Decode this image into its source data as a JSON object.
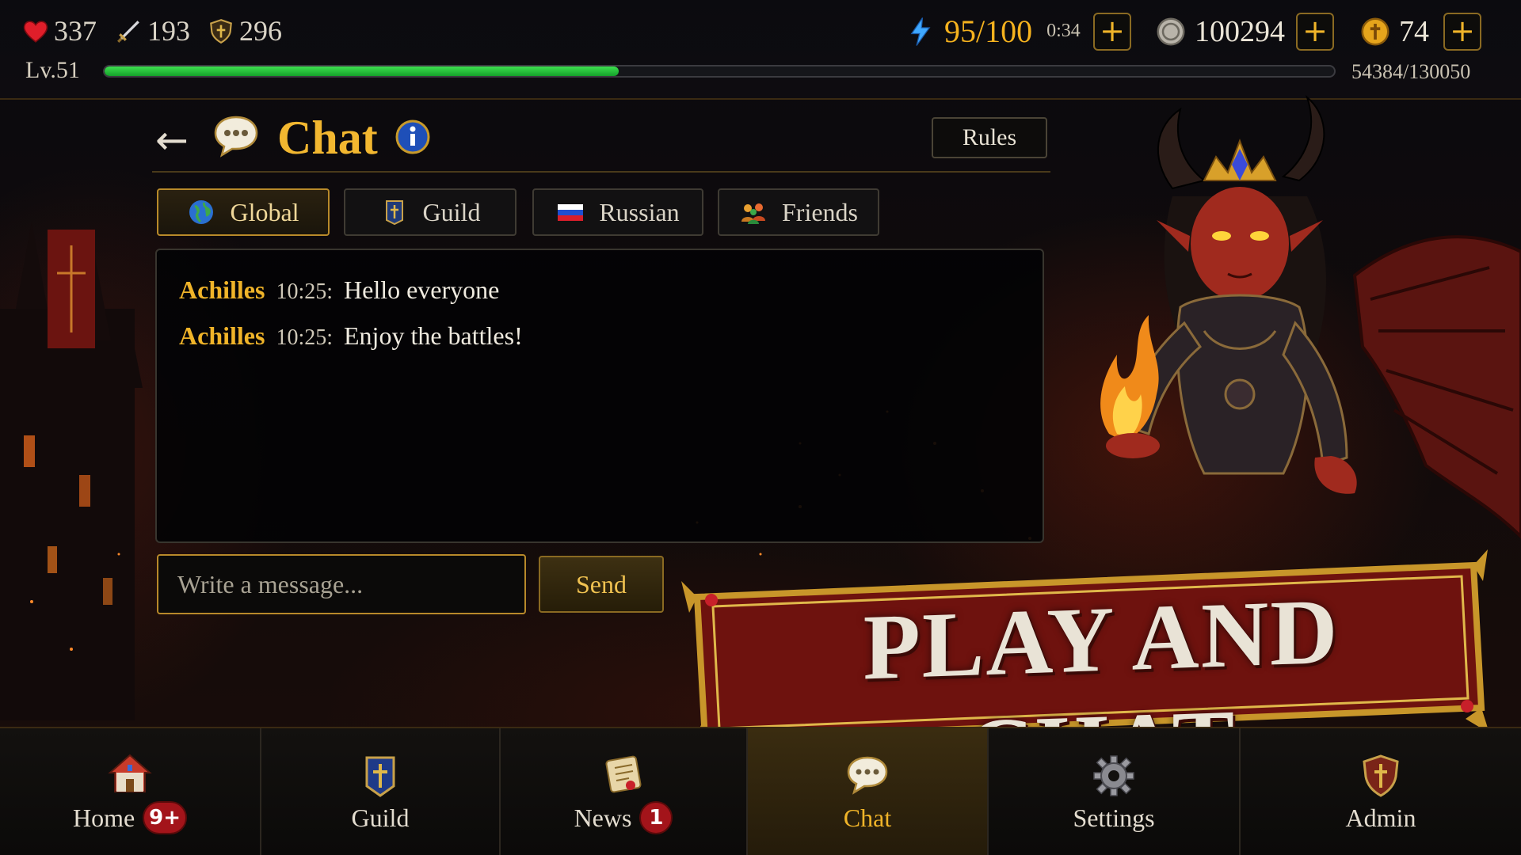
{
  "stats": {
    "hp": "337",
    "attack": "193",
    "defense": "296",
    "energy": "95/100",
    "energy_timer": "0:34",
    "coins": "100294",
    "gems": "74"
  },
  "plus_label": "+",
  "level": {
    "label": "Lv.51",
    "xp_text": "54384/130050",
    "xp_current": 54384,
    "xp_max": 130050
  },
  "header": {
    "back": "←",
    "title": "Chat",
    "rules": "Rules"
  },
  "tabs": [
    {
      "label": "Global",
      "icon": "globe-icon",
      "active": true
    },
    {
      "label": "Guild",
      "icon": "guild-banner-icon",
      "active": false
    },
    {
      "label": "Russian",
      "icon": "russia-flag-icon",
      "active": false
    },
    {
      "label": "Friends",
      "icon": "friends-icon",
      "active": false
    }
  ],
  "messages": [
    {
      "user": "Achilles",
      "time": "10:25:",
      "text": "Hello everyone"
    },
    {
      "user": "Achilles",
      "time": "10:25:",
      "text": "Enjoy the battles!"
    }
  ],
  "composer": {
    "placeholder": "Write a message...",
    "send": "Send"
  },
  "banner": {
    "text": "PLAY AND CHAT"
  },
  "nav": [
    {
      "label": "Home",
      "icon": "home-icon",
      "badge": "9+",
      "active": false
    },
    {
      "label": "Guild",
      "icon": "guild-icon",
      "badge": "",
      "active": false
    },
    {
      "label": "News",
      "icon": "scroll-icon",
      "badge": "1",
      "active": false
    },
    {
      "label": "Chat",
      "icon": "chat-bubble-icon",
      "badge": "",
      "active": true
    },
    {
      "label": "Settings",
      "icon": "gear-icon",
      "badge": "",
      "active": false
    },
    {
      "label": "Admin",
      "icon": "admin-shield-icon",
      "badge": "",
      "active": false
    }
  ],
  "colors": {
    "accent_gold": "#f0b429",
    "xp_green": "#2bc93e",
    "badge_red": "#a3141a",
    "banner_red": "#7a1410"
  }
}
